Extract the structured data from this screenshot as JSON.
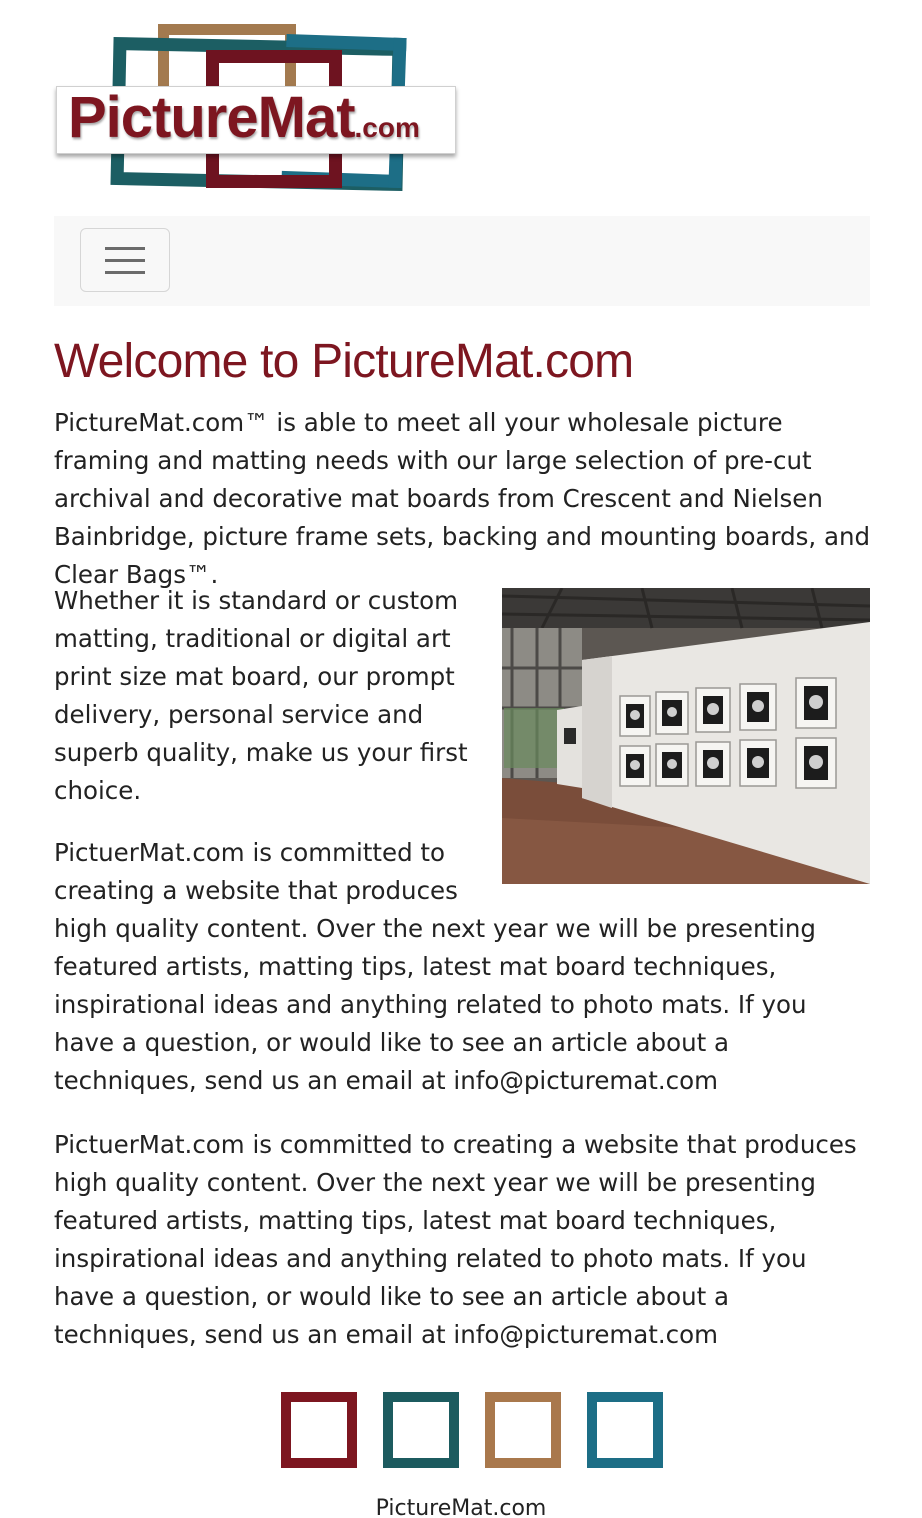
{
  "logo": {
    "name": "PictureMat",
    "suffix": ".com"
  },
  "navbar": {
    "toggle_icon": "hamburger-icon"
  },
  "main": {
    "title": "Welcome to PictureMat.com",
    "intro": "PictureMat.com™ is able to meet all your wholesale picture framing and matting needs with our large selection of pre-cut archival and decorative mat boards from Crescent and Nielsen Bainbridge, picture frame sets, backing and mounting boards, and Clear Bags™.",
    "paragraph_2": "Whether it is standard or custom matting, traditional or digital art print size mat board, our prompt delivery, personal service and superb quality, make us your first choice.",
    "paragraph_3": "PictuerMat.com is committed to creating a website that produces high quality content. Over the next year we will be presenting featured artists, matting tips, latest mat board techniques, inspirational ideas and anything related to photo mats. If you have a question, or would like to see an article about a techniques, send us an email at info@picturemat.com",
    "paragraph_4": "PictuerMat.com is committed to creating a website that produces high quality content. Over the next year we will be presenting featured artists, matting tips, latest mat board techniques, inspirational ideas and anything related to photo mats. If you have a question, or would like to see an article about a techniques, send us an email at info@picturemat.com"
  },
  "footer": {
    "frame_colors": [
      "#7d1620",
      "#1c5b5f",
      "#a9784c",
      "#1d6e86"
    ],
    "text": "PictureMat.com"
  },
  "colors": {
    "brand_red": "#7d1620",
    "brand_teal": "#1c5e63",
    "brand_tan": "#a37a4f",
    "brand_blue": "#1d6e86",
    "navbar_bg": "#f8f8f8"
  }
}
